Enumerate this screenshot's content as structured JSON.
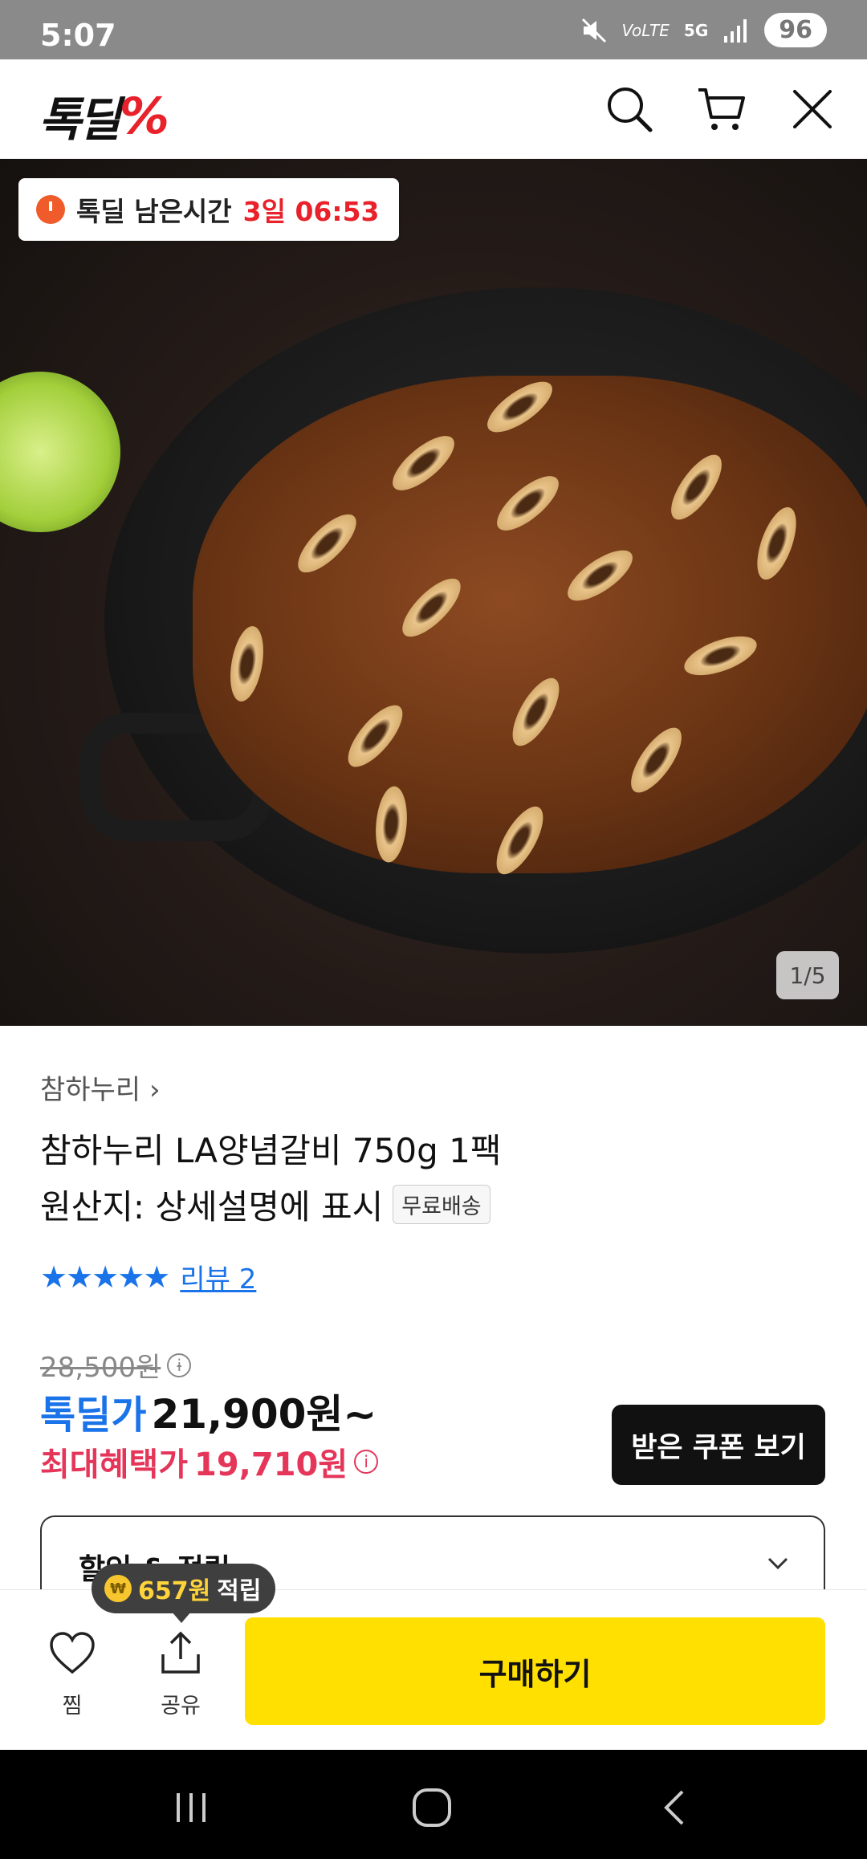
{
  "status_bar": {
    "time": "5:07",
    "network": "5G",
    "carrier_badge": "VoLTE",
    "battery": "96"
  },
  "header": {
    "logo_text": "톡딜",
    "logo_mark": "%",
    "icons": [
      "search-icon",
      "cart-icon",
      "close-icon"
    ]
  },
  "hero": {
    "timer_label": "톡딜 남은시간",
    "timer_value": "3일 06:53",
    "image_counter": "1/5"
  },
  "product": {
    "brand": "참하누리",
    "brand_chevron": "›",
    "title": "참하누리 LA양념갈비 750g 1팩",
    "origin": "원산지: 상세설명에 표시",
    "shipping_badge": "무료배송",
    "rating_stars": "★★★★★",
    "review_link": "리뷰 2"
  },
  "pricing": {
    "original_price": "28,500원",
    "deal_label": "톡딜가",
    "deal_price": "21,900원~",
    "max_label": "최대혜택가",
    "max_price": "19,710원",
    "coupon_button": "받은 쿠폰 보기",
    "discount_section_title": "할인 & 적립"
  },
  "bottom_bar": {
    "wish_label": "찜",
    "share_label": "공유",
    "buy_label": "구매하기",
    "points_coin": "₩",
    "points_amount": "657원",
    "points_suffix": "적립"
  },
  "colors": {
    "brand_red": "#e8212b",
    "deal_blue": "#1a73e8",
    "max_price_pink": "#e5365a",
    "buy_yellow": "#ffe000"
  }
}
